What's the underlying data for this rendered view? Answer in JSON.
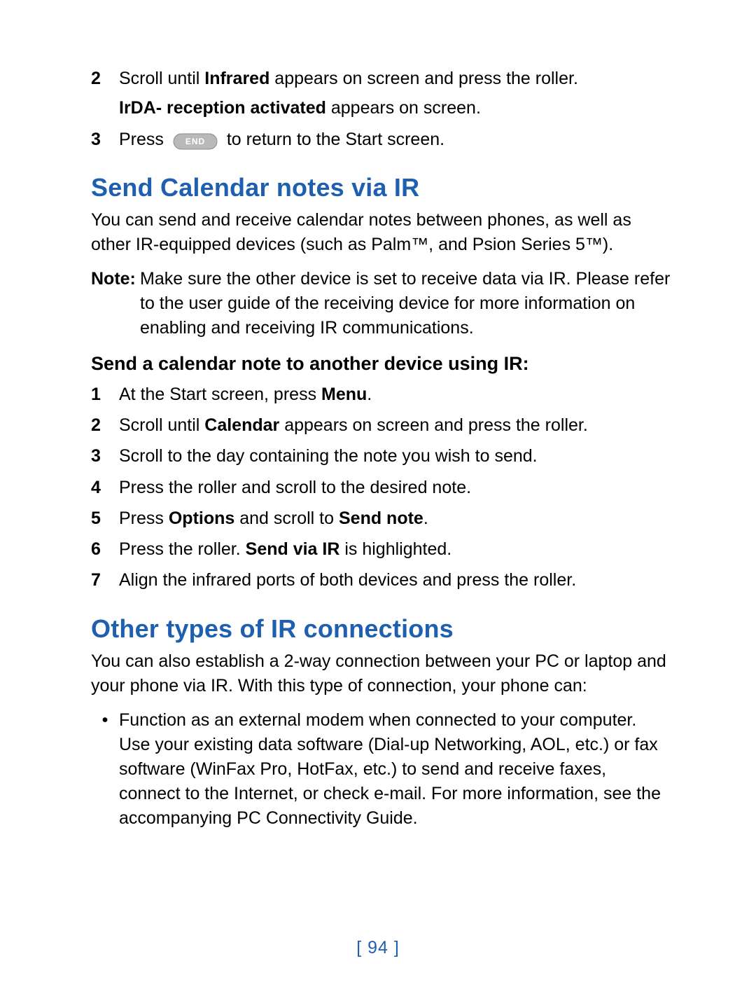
{
  "intro_steps": {
    "2": {
      "num": "2",
      "pre": "Scroll until ",
      "b1": "Infrared",
      "post": " appears on screen and press the roller.",
      "sub_b": "IrDA- reception activated",
      "sub_post": " appears on screen."
    },
    "3": {
      "num": "3",
      "pre": "Press ",
      "pill": "END",
      "post": " to return to the Start screen."
    }
  },
  "section1": {
    "title": "Send Calendar notes via IR",
    "para": "You can send and receive calendar notes between phones, as well as other IR-equipped devices (such as Palm™, and Psion Series 5™).",
    "note_label": "Note:",
    "note_body": "Make sure the other device is set to receive data via IR. Please refer to the user guide of the receiving device for more information on enabling and receiving IR communications.",
    "sub_title": "Send a calendar note to another device using IR:",
    "steps": [
      {
        "num": "1",
        "pre": "At the Start screen, press ",
        "b1": "Menu",
        "post": "."
      },
      {
        "num": "2",
        "pre": "Scroll until ",
        "b1": "Calendar",
        "post": " appears on screen and press the roller."
      },
      {
        "num": "3",
        "pre": "Scroll to the day containing the note you wish to send.",
        "b1": "",
        "post": ""
      },
      {
        "num": "4",
        "pre": "Press the roller and scroll to the desired note.",
        "b1": "",
        "post": ""
      },
      {
        "num": "5",
        "pre": "Press ",
        "b1": "Options",
        "mid": " and scroll to ",
        "b2": "Send note",
        "post": "."
      },
      {
        "num": "6",
        "pre": "Press the roller. ",
        "b1": "Send via IR",
        "post": " is highlighted."
      },
      {
        "num": "7",
        "pre": "Align the infrared ports of both devices and press the roller.",
        "b1": "",
        "post": ""
      }
    ]
  },
  "section2": {
    "title": "Other types of IR connections",
    "para": "You can also establish a 2-way connection between your PC or laptop and your phone via IR. With this type of connection, your phone can:",
    "bullet": "Function as an external modem when connected to your computer. Use your existing data software (Dial-up Networking, AOL, etc.) or fax software (WinFax Pro, HotFax, etc.) to send and receive faxes, connect to the Internet, or check e-mail. For more information, see the accompanying PC Connectivity Guide."
  },
  "page_number": "[ 94 ]"
}
